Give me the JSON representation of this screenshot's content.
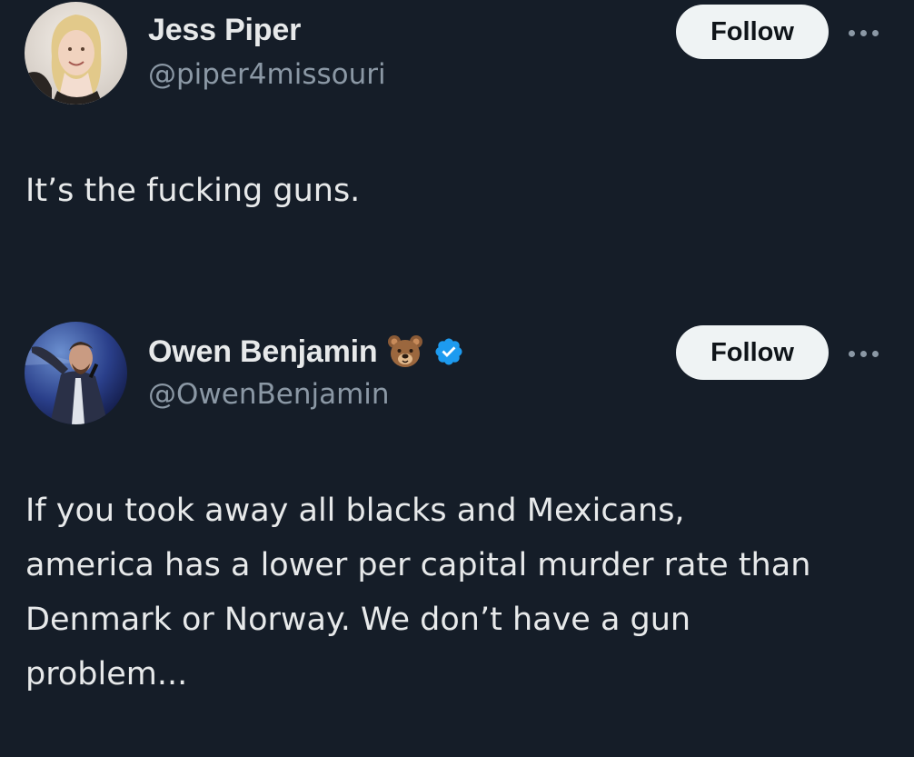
{
  "tweets": [
    {
      "display_name": "Jess Piper",
      "handle": "@piper4missouri",
      "follow_label": "Follow",
      "text": "It’s the fucking guns.",
      "verified": false,
      "avatar": "profile-photo"
    },
    {
      "display_name": "Owen Benjamin",
      "name_emoji": "bear-face-icon",
      "handle": "@OwenBenjamin",
      "follow_label": "Follow",
      "text": "If you took away all blacks and Mexicans,\namerica has a lower per capital murder rate than\nDenmark or Norway. We don’t have a gun\nproblem...",
      "verified": true,
      "avatar": "profile-photo"
    }
  ],
  "colors": {
    "background": "#151d28",
    "text_primary": "#e7e9ea",
    "text_secondary": "#8b98a5",
    "button_bg": "#eff3f4",
    "button_text": "#0f1419",
    "verified_blue": "#1d9bf0"
  }
}
